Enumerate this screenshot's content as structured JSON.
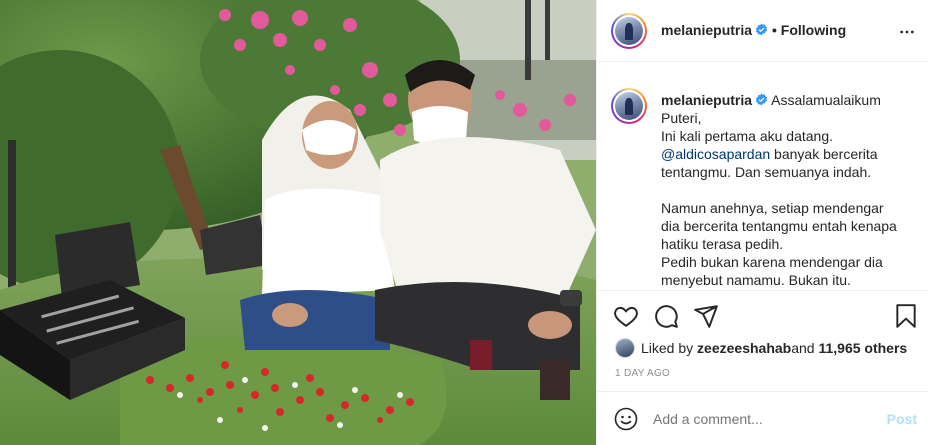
{
  "post": {
    "image_alt": "",
    "header": {
      "username": "melanieputria",
      "separator": "•",
      "follow_status": "Following"
    },
    "caption": {
      "username": "melanieputria",
      "lines": [
        "Assalamualaikum",
        "Puteri,",
        "Ini kali pertama aku datang."
      ],
      "mention": "@aldicosapardan",
      "mention_rest": " banyak bercerita",
      "lines2": [
        "tentangmu. Dan semuanya indah."
      ],
      "lines3": [
        "Namun anehnya, setiap mendengar",
        "dia bercerita tentangmu entah kenapa",
        "hatiku terasa pedih.",
        "Pedih bukan karena mendengar dia",
        "menyebut namamu. Bukan itu."
      ]
    },
    "likes": {
      "prefix": "Liked by ",
      "user": "zeezeeshahab",
      "middle": " and ",
      "count": "11,965 others"
    },
    "timestamp": "1 day ago",
    "comment": {
      "placeholder": "Add a comment...",
      "post_label": "Post"
    }
  },
  "colors": {
    "text": "#262626",
    "secondary": "#8e8e8e",
    "verified": "#3897f0",
    "post_disabled": "#b2dffc",
    "mention": "#00376b"
  },
  "icons": [
    "verified-badge-icon",
    "more-options-icon",
    "heart-icon",
    "comment-icon",
    "share-icon",
    "bookmark-icon",
    "emoji-icon"
  ]
}
